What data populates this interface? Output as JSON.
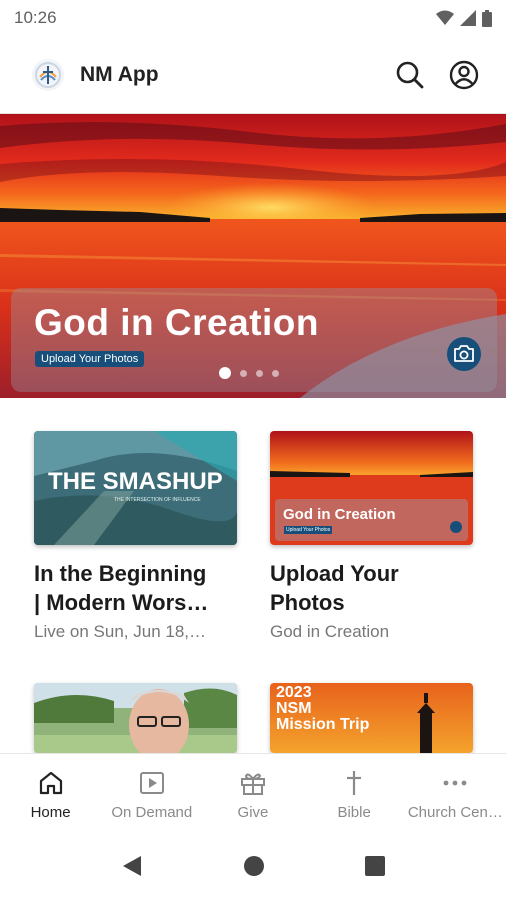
{
  "status_bar": {
    "time": "10:26"
  },
  "app_bar": {
    "title": "NM App",
    "search_icon": "search-icon",
    "account_icon": "account-icon"
  },
  "hero": {
    "title": "God in Creation",
    "tag": "Upload Your Photos",
    "slide_count": 4,
    "active_slide": 1,
    "camera_icon": "camera-icon"
  },
  "cards": [
    {
      "thumb_heading": "THE SMASHUP",
      "thumb_subheading": "THE INTERSECTION OF INFLUENCE",
      "title_line1": "In the Beginning",
      "title_line2": "| Modern Wors…",
      "subtitle": "Live on Sun, Jun 18,…"
    },
    {
      "thumb_heading": "God in Creation",
      "thumb_tag": "Upload Your Photos",
      "title_line1": "Upload Your",
      "title_line2": "Photos",
      "subtitle": "God in Creation"
    },
    {
      "thumb_heading": ""
    },
    {
      "thumb_heading": "2023 NSM Mission Trip",
      "thumb_line1": "2023",
      "thumb_line2": "NSM",
      "thumb_line3": "Mission Trip"
    }
  ],
  "bottom_nav": [
    {
      "label": "Home",
      "icon": "home-icon",
      "active": true
    },
    {
      "label": "On Demand",
      "icon": "play-icon",
      "active": false
    },
    {
      "label": "Give",
      "icon": "gift-icon",
      "active": false
    },
    {
      "label": "Bible",
      "icon": "cross-icon",
      "active": false
    },
    {
      "label": "Church Cen…",
      "icon": "more-icon",
      "active": false
    }
  ],
  "colors": {
    "accent": "#174f7a",
    "sunset_red": "#e2261c",
    "sunset_orange": "#f7941d"
  }
}
